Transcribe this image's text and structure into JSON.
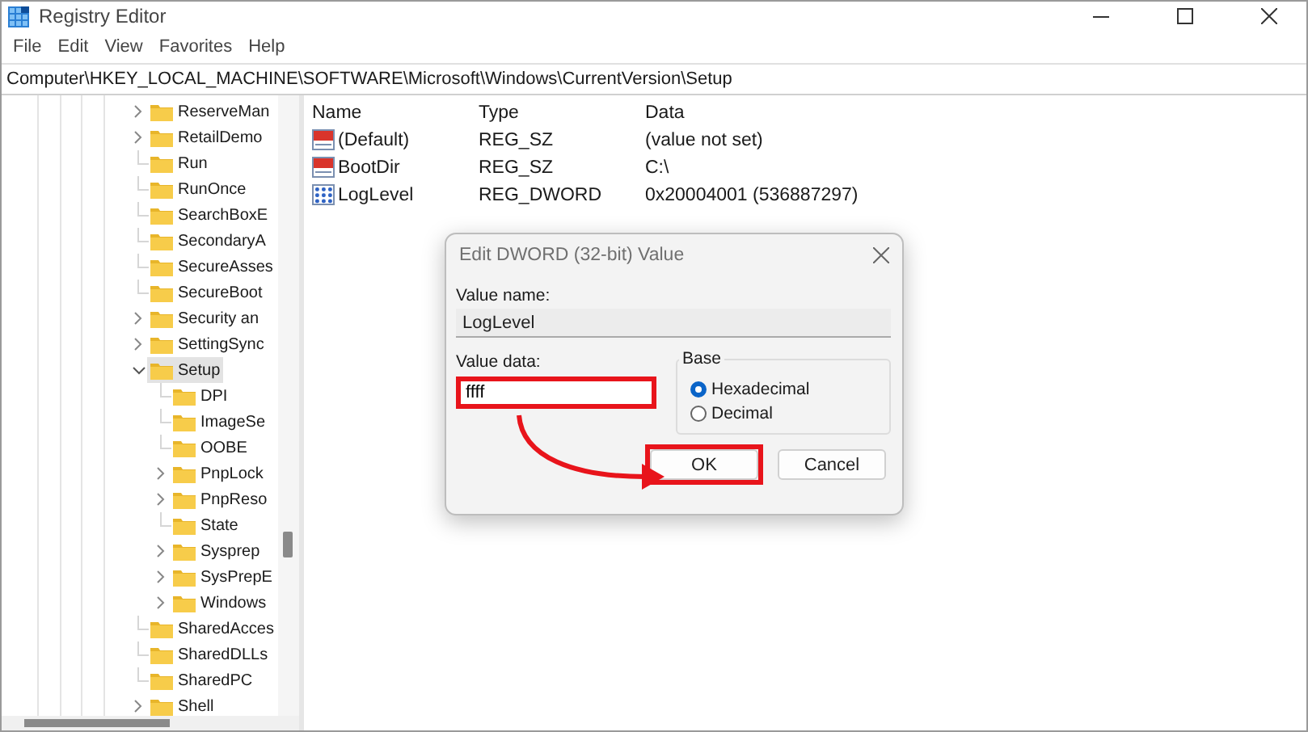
{
  "window": {
    "title": "Registry Editor"
  },
  "menu": [
    "File",
    "Edit",
    "View",
    "Favorites",
    "Help"
  ],
  "address": "Computer\\HKEY_LOCAL_MACHINE\\SOFTWARE\\Microsoft\\Windows\\CurrentVersion\\Setup",
  "tree": [
    {
      "label": "ReserveMan",
      "expandable": true,
      "expanded": false,
      "selected": false
    },
    {
      "label": "RetailDemo",
      "expandable": true,
      "expanded": false,
      "selected": false
    },
    {
      "label": "Run",
      "expandable": false,
      "selected": false
    },
    {
      "label": "RunOnce",
      "expandable": false,
      "selected": false
    },
    {
      "label": "SearchBoxE",
      "expandable": false,
      "selected": false
    },
    {
      "label": "SecondaryA",
      "expandable": false,
      "selected": false
    },
    {
      "label": "SecureAsses",
      "expandable": false,
      "selected": false
    },
    {
      "label": "SecureBoot",
      "expandable": false,
      "selected": false
    },
    {
      "label": "Security an",
      "expandable": true,
      "expanded": false,
      "selected": false
    },
    {
      "label": "SettingSync",
      "expandable": true,
      "expanded": false,
      "selected": false
    },
    {
      "label": "Setup",
      "expandable": true,
      "expanded": true,
      "selected": true,
      "children": [
        {
          "label": "DPI",
          "expandable": false,
          "selected": false
        },
        {
          "label": "ImageSe",
          "expandable": false,
          "selected": false
        },
        {
          "label": "OOBE",
          "expandable": false,
          "selected": false
        },
        {
          "label": "PnpLock",
          "expandable": true,
          "expanded": false,
          "selected": false
        },
        {
          "label": "PnpReso",
          "expandable": true,
          "expanded": false,
          "selected": false
        },
        {
          "label": "State",
          "expandable": false,
          "selected": false
        },
        {
          "label": "Sysprep",
          "expandable": true,
          "expanded": false,
          "selected": false
        },
        {
          "label": "SysPrepE",
          "expandable": true,
          "expanded": false,
          "selected": false
        },
        {
          "label": "Windows",
          "expandable": true,
          "expanded": false,
          "selected": false
        }
      ]
    },
    {
      "label": "SharedAcces",
      "expandable": false,
      "selected": false
    },
    {
      "label": "SharedDLLs",
      "expandable": false,
      "selected": false
    },
    {
      "label": "SharedPC",
      "expandable": false,
      "selected": false
    },
    {
      "label": "Shell",
      "expandable": true,
      "expanded": false,
      "selected": false
    }
  ],
  "values": {
    "columns": [
      "Name",
      "Type",
      "Data"
    ],
    "rows": [
      {
        "kind": "string",
        "name": "(Default)",
        "type": "REG_SZ",
        "data": "(value not set)"
      },
      {
        "kind": "string",
        "name": "BootDir",
        "type": "REG_SZ",
        "data": "C:\\"
      },
      {
        "kind": "binary",
        "name": "LogLevel",
        "type": "REG_DWORD",
        "data": "0x20004001 (536887297)"
      }
    ]
  },
  "dialog": {
    "title": "Edit DWORD (32-bit) Value",
    "value_name_label": "Value name:",
    "value_name": "LogLevel",
    "value_data_label": "Value data:",
    "value_data": "ffff",
    "value_data_highlighted": true,
    "base_label": "Base",
    "base_options": [
      {
        "label": "Hexadecimal",
        "selected": true
      },
      {
        "label": "Decimal",
        "selected": false
      }
    ],
    "buttons": [
      {
        "label": "OK",
        "highlighted": true
      },
      {
        "label": "Cancel",
        "highlighted": false
      }
    ]
  }
}
